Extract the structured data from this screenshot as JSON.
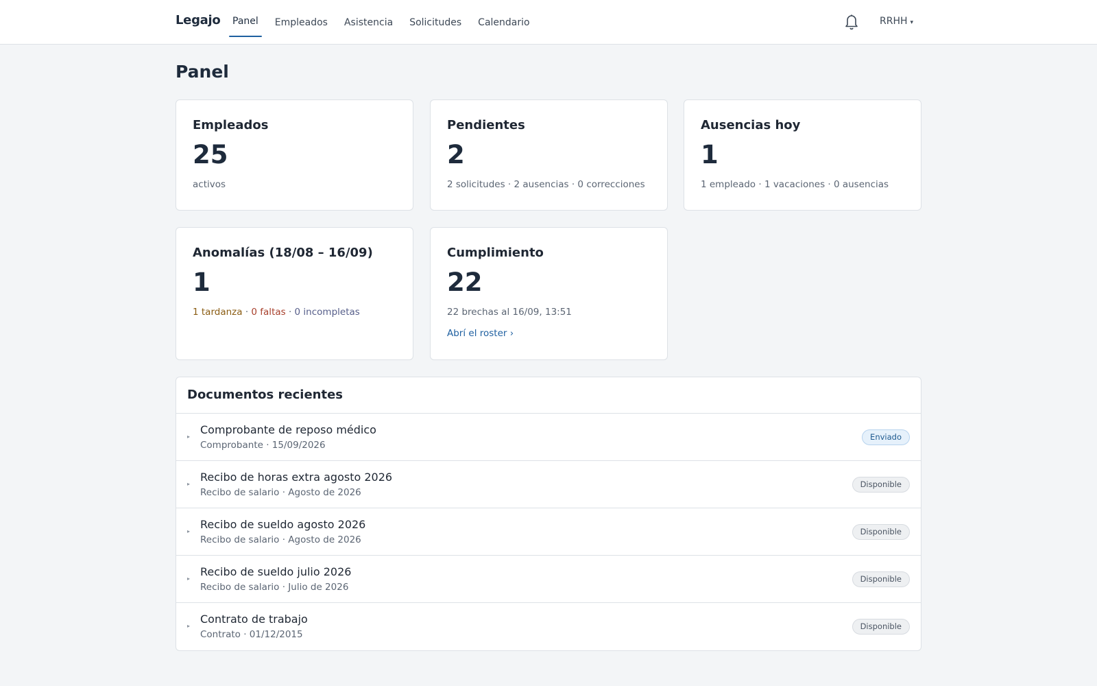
{
  "brand": "Legajo",
  "nav": [
    {
      "label": "Panel",
      "active": true
    },
    {
      "label": "Empleados",
      "active": false
    },
    {
      "label": "Asistencia",
      "active": false
    },
    {
      "label": "Solicitudes",
      "active": false
    },
    {
      "label": "Calendario",
      "active": false
    }
  ],
  "header": {
    "bell_icon": "bell-icon",
    "user_label": "RRHH",
    "user_caret": "▾"
  },
  "page_title": "Panel",
  "cards": {
    "empleados": {
      "title": "Empleados",
      "value": "25",
      "sub": "activos"
    },
    "pendientes": {
      "title": "Pendientes",
      "value": "2",
      "sub": "2 solicitudes · 2 ausencias · 0 correcciones"
    },
    "ausencias": {
      "title": "Ausencias hoy",
      "value": "1",
      "sub": "1 empleado · 1 vacaciones · 0 ausencias"
    },
    "anomalias": {
      "title": "Anomalías (18/08 – 16/09)",
      "value": "1",
      "late": "1 tardanza",
      "sep1": " · ",
      "absent": "0 faltas",
      "sep2": " · ",
      "incomplete": "0 incompletas",
      "colors": {
        "late": "#8a5c12",
        "absent": "#a8402c",
        "incomplete": "#565e8a"
      }
    },
    "cumplimiento": {
      "title": "Cumplimiento",
      "value": "22",
      "sub": "22 brechas al 16/09, 13:51",
      "link": "Abrí el roster ›"
    }
  },
  "documents": {
    "title": "Documentos recientes",
    "items": [
      {
        "name": "Comprobante de reposo médico",
        "meta": "Comprobante · 15/09/2026",
        "status": "Enviado",
        "status_type": "sent"
      },
      {
        "name": "Recibo de horas extra agosto 2026",
        "meta": "Recibo de salario · Agosto de 2026",
        "status": "Disponible",
        "status_type": "available"
      },
      {
        "name": "Recibo de sueldo agosto 2026",
        "meta": "Recibo de salario · Agosto de 2026",
        "status": "Disponible",
        "status_type": "available"
      },
      {
        "name": "Recibo de sueldo julio 2026",
        "meta": "Recibo de salario · Julio de 2026",
        "status": "Disponible",
        "status_type": "available"
      },
      {
        "name": "Contrato de trabajo",
        "meta": "Contrato · 01/12/2015",
        "status": "Disponible",
        "status_type": "available"
      }
    ]
  },
  "colors": {
    "accent": "#1e5fa0",
    "background": "#f3f5f7",
    "badge_sent_bg": "#e6f1fb",
    "badge_available_bg": "#eef0f2"
  }
}
